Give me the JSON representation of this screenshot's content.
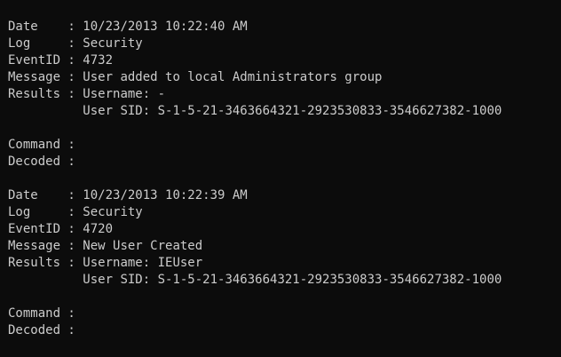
{
  "terminal": {
    "blocks": [
      {
        "date_label": "Date    : ",
        "date": "10/23/2013 10:22:40 AM",
        "log_label": "Log     : ",
        "log": "Security",
        "eventid_label": "EventID : ",
        "eventid": "4732",
        "message_label": "Message : ",
        "message": "User added to local Administrators group",
        "results_label": "Results : ",
        "results_username": "Username: -",
        "results_indent": "          ",
        "results_sid": "User SID: S-1-5-21-3463664321-2923530833-3546627382-1000",
        "command_label": "Command : ",
        "command": "",
        "decoded_label": "Decoded : ",
        "decoded": ""
      },
      {
        "date_label": "Date    : ",
        "date": "10/23/2013 10:22:39 AM",
        "log_label": "Log     : ",
        "log": "Security",
        "eventid_label": "EventID : ",
        "eventid": "4720",
        "message_label": "Message : ",
        "message": "New User Created",
        "results_label": "Results : ",
        "results_username": "Username: IEUser",
        "results_indent": "          ",
        "results_sid": "User SID: S-1-5-21-3463664321-2923530833-3546627382-1000",
        "command_label": "Command : ",
        "command": "",
        "decoded_label": "Decoded : ",
        "decoded": ""
      }
    ]
  }
}
